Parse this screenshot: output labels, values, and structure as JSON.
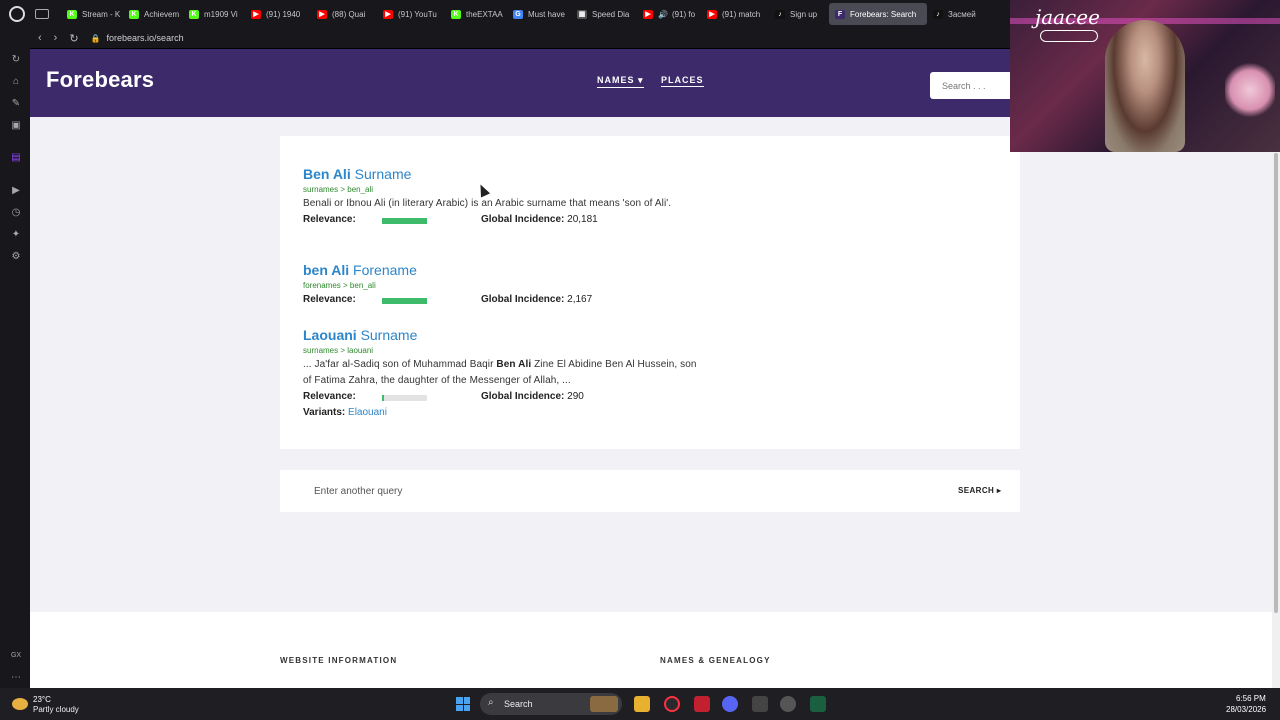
{
  "browser": {
    "tabs": [
      {
        "label": "Stream - K",
        "fav_color": "#53fc18",
        "fav_glyph": "K"
      },
      {
        "label": "Achievem",
        "fav_color": "#53fc18",
        "fav_glyph": "K"
      },
      {
        "label": "m1909 Vi",
        "fav_color": "#53fc18",
        "fav_glyph": "K"
      },
      {
        "label": "(91) 1940",
        "fav_color": "#ff0000",
        "fav_glyph": "▶"
      },
      {
        "label": "(88) Quai",
        "fav_color": "#ff0000",
        "fav_glyph": "▶"
      },
      {
        "label": "(91) YouTu",
        "fav_color": "#ff0000",
        "fav_glyph": "▶"
      },
      {
        "label": "theEXTAA",
        "fav_color": "#53fc18",
        "fav_glyph": "K"
      },
      {
        "label": "Must have",
        "fav_color": "#4285f4",
        "fav_glyph": "G"
      },
      {
        "label": "Speed Dia",
        "fav_color": "#555555",
        "fav_glyph": "▦"
      },
      {
        "label": "(91) fo",
        "fav_color": "#ff0000",
        "fav_glyph": "▶"
      },
      {
        "label": "(91) match",
        "fav_color": "#ff0000",
        "fav_glyph": "▶"
      },
      {
        "label": "Sign up",
        "fav_color": "#111111",
        "fav_glyph": "♪"
      },
      {
        "label": "Forebears: Search",
        "fav_color": "#3c2a6b",
        "fav_glyph": "F"
      },
      {
        "label": "Засмей",
        "fav_color": "#111111",
        "fav_glyph": "♪"
      }
    ],
    "active_tab_index": 12,
    "url": "forebears.io/search"
  },
  "site": {
    "logo": "Forebears",
    "nav": {
      "names": "NAMES",
      "places": "PLACES"
    },
    "search_placeholder": "Search . . ."
  },
  "results": [
    {
      "name": "Ben Ali",
      "type": "Surname",
      "crumb": "surnames > ben_ali",
      "description": "Benali or Ibnou Ali (in literary Arabic) is an Arabic surname that means 'son of Ali'.",
      "relevance_label": "Relevance:",
      "relevance": 1.0,
      "incidence_label": "Global Incidence:",
      "incidence": "20,181"
    },
    {
      "name": "ben Ali",
      "type": "Forename",
      "crumb": "forenames > ben_ali",
      "relevance_label": "Relevance:",
      "relevance": 1.0,
      "incidence_label": "Global Incidence:",
      "incidence": "2,167"
    },
    {
      "name": "Laouani",
      "type": "Surname",
      "crumb": "surnames > laouani",
      "description_pre": "... Ja'far al-Sadiq son of Muhammad Baqir ",
      "description_bold": "Ben Ali",
      "description_post": " Zine El Abidine Ben Al Hussein, son of Fatima Zahra, the daughter of the Messenger of Allah, ...",
      "relevance_label": "Relevance:",
      "relevance": 0.05,
      "incidence_label": "Global Incidence:",
      "incidence": "290",
      "variants_label": "Variants:",
      "variants": "Elaouani"
    }
  ],
  "query": {
    "placeholder": "Enter another query",
    "button": "SEARCH"
  },
  "footer": {
    "website_info": "WEBSITE INFORMATION",
    "names_genealogy": "NAMES & GENEALOGY"
  },
  "webcam": {
    "name": "jaacee"
  },
  "taskbar": {
    "temperature": "23°C",
    "weather": "Partly cloudy",
    "search": "Search",
    "time": "6:56 PM",
    "date": "28/03/2026"
  }
}
